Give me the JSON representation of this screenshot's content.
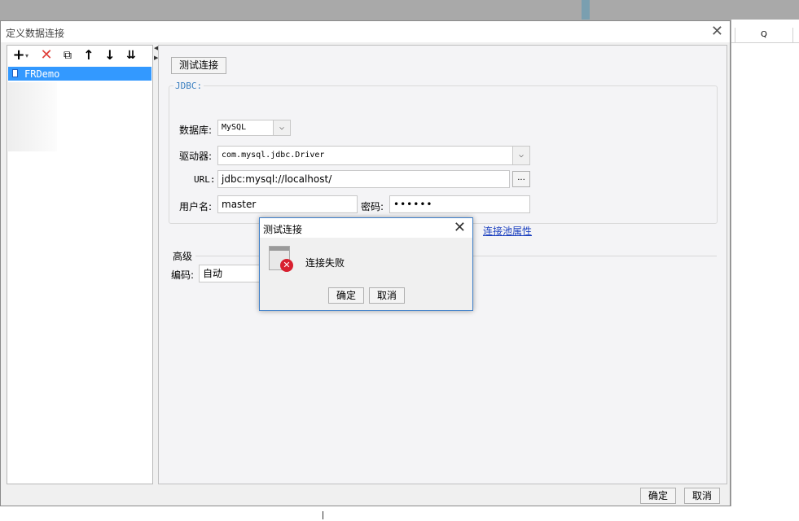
{
  "background": {
    "column_letter": "Q"
  },
  "dialog": {
    "title": "定义数据连接",
    "close_glyph": "✕",
    "footer": {
      "ok_label": "确定",
      "cancel_label": "取消"
    }
  },
  "toolbar": {
    "add_glyph": "+",
    "add_arrow_glyph": "▾",
    "delete_glyph": "✕",
    "copy_glyph": "⧉",
    "up_glyph": "↑",
    "down_glyph": "↓",
    "sort_glyph": "⇊"
  },
  "tree": {
    "items": [
      {
        "label": "FRDemo",
        "selected": true
      }
    ]
  },
  "connection": {
    "test_button_label": "测试连接",
    "jdbc_legend": "JDBC:",
    "database_label": "数据库:",
    "database_value": "MySQL",
    "driver_label": "驱动器:",
    "driver_value": "com.mysql.jdbc.Driver",
    "url_label": "URL:",
    "url_value": "jdbc:mysql://localhost/",
    "url_browse_label": "...",
    "username_label": "用户名:",
    "username_value": "master",
    "password_label": "密码:",
    "password_value": "••••••",
    "pool_link": "连接池属性",
    "dropdown_glyph": "⌵"
  },
  "advanced": {
    "title": "高级",
    "encoding_label": "编码:",
    "encoding_value": "自动"
  },
  "message_box": {
    "title": "测试连接",
    "close_glyph": "✕",
    "error_glyph": "✕",
    "message": "连接失败",
    "ok_label": "确定",
    "cancel_label": "取消"
  }
}
